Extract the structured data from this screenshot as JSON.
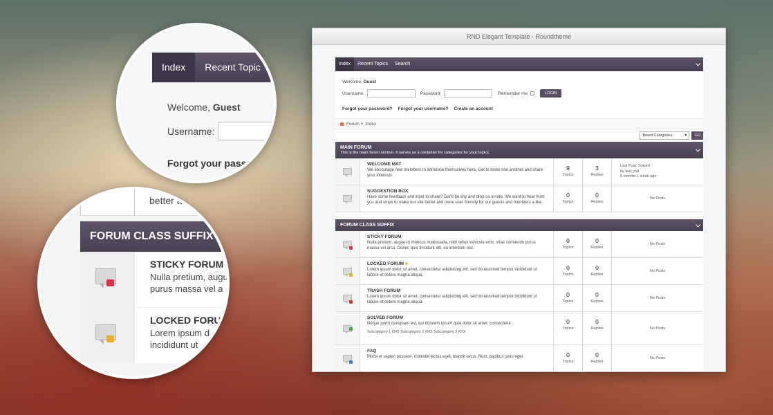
{
  "window": {
    "title": "RND Elegant Template - Roundtheme"
  },
  "nav": {
    "items": [
      "Index",
      "Recent Topics",
      "Search"
    ]
  },
  "login": {
    "welcome_prefix": "Welcome,",
    "welcome_name": "Guest",
    "username_label": "Username:",
    "password_label": "Password:",
    "remember_label": "Remember me",
    "login_button": "LOGIN",
    "forgot_password": "Forgot your password?",
    "forgot_username": "Forgot your username?",
    "create_account": "Create an account"
  },
  "breadcrumb": {
    "items": [
      "Forum",
      "Index"
    ]
  },
  "categories": {
    "selected": "Board Categories",
    "go": "GO"
  },
  "main_forum": {
    "title": "MAIN FORUM",
    "description": "This is the main forum section. It serves as a container for categories for your topics.",
    "rows": [
      {
        "title": "WELCOME MAT",
        "desc": "We encourage new members to introduce themselves here. Get to know one another and share your interests.",
        "topics": "9",
        "replies": "3",
        "last1": "Last Post: Solved",
        "last2": "by test_md",
        "last3": "5 months 1 week ago"
      },
      {
        "title": "SUGGESTION BOX",
        "desc": "Have some feedback and input to share? Don't be shy and drop us a note. We want to hear from you and strive to make our site better and more user friendly for our guests and members a like.",
        "topics": "0",
        "replies": "0",
        "last": "No Posts"
      }
    ]
  },
  "suffix_forum": {
    "title": "FORUM CLASS SUFFIX",
    "rows": [
      {
        "title": "STICKY FORUM",
        "desc": "Nulla pretium, augue id rhoncus malesuada, nibh tellus vehicula eros, vitae commodo purus massa vel arcu. Donec quis tincidunt elit, eu interdum nisl.",
        "topics": "0",
        "replies": "0",
        "last": "No Posts"
      },
      {
        "title": "LOCKED FORUM",
        "desc": "Lorem ipsum dolor sit amet, consectetur adipisicing elit, sed do eiusmod tempor incididunt ut labore et dolore magna aliqua.",
        "topics": "0",
        "replies": "0",
        "last": "No Posts"
      },
      {
        "title": "TRASH FORUM",
        "desc": "Lorem ipsum dolor sit amet, consectetur adipisicing elit, sed do eiusmod tempor incididunt ut labore et dolore magna aliqua.",
        "topics": "0",
        "replies": "0",
        "last": "No Posts"
      },
      {
        "title": "SOLVED FORUM",
        "desc": "Neque porro quisquam est, qui dolorem ipsum quia dolor sit amet, consectetur...",
        "subcats": "Subcategory 1 (0/0)   Subcategory 2 (0/0)   Subcategory 3 (0/0)",
        "topics": "0",
        "replies": "0",
        "last": "No Posts"
      },
      {
        "title": "FAQ",
        "desc": "Morbi et sapien posuere, molestie lectus eget, blandit lacus. Nunc dapibus justo eget",
        "topics": "0",
        "replies": "0",
        "last": "No Posts"
      }
    ]
  },
  "labels": {
    "topics": "Topics",
    "replies": "Replies"
  },
  "zoom1": {
    "index": "Index",
    "recent": "Recent Topic",
    "welcome": "Welcome,",
    "guest": "Guest",
    "username": "Username:",
    "forgot": "Forgot your pass"
  },
  "zoom2": {
    "above": "better a",
    "header": "FORUM CLASS SUFFIX",
    "sticky_title": "STICKY FORUM",
    "sticky_desc": "Nulla pretium, augu purus massa vel a",
    "locked_title": "LOCKED FORU",
    "locked_desc": "Lorem ipsum d incididunt ut"
  },
  "colors": {
    "nav": "#4f4559",
    "sticky_mark": "#d9334b",
    "locked_mark": "#e8b030",
    "trash_mark": "#d93a3a",
    "solved_mark": "#4caf50",
    "faq_mark": "#3b82c4"
  }
}
